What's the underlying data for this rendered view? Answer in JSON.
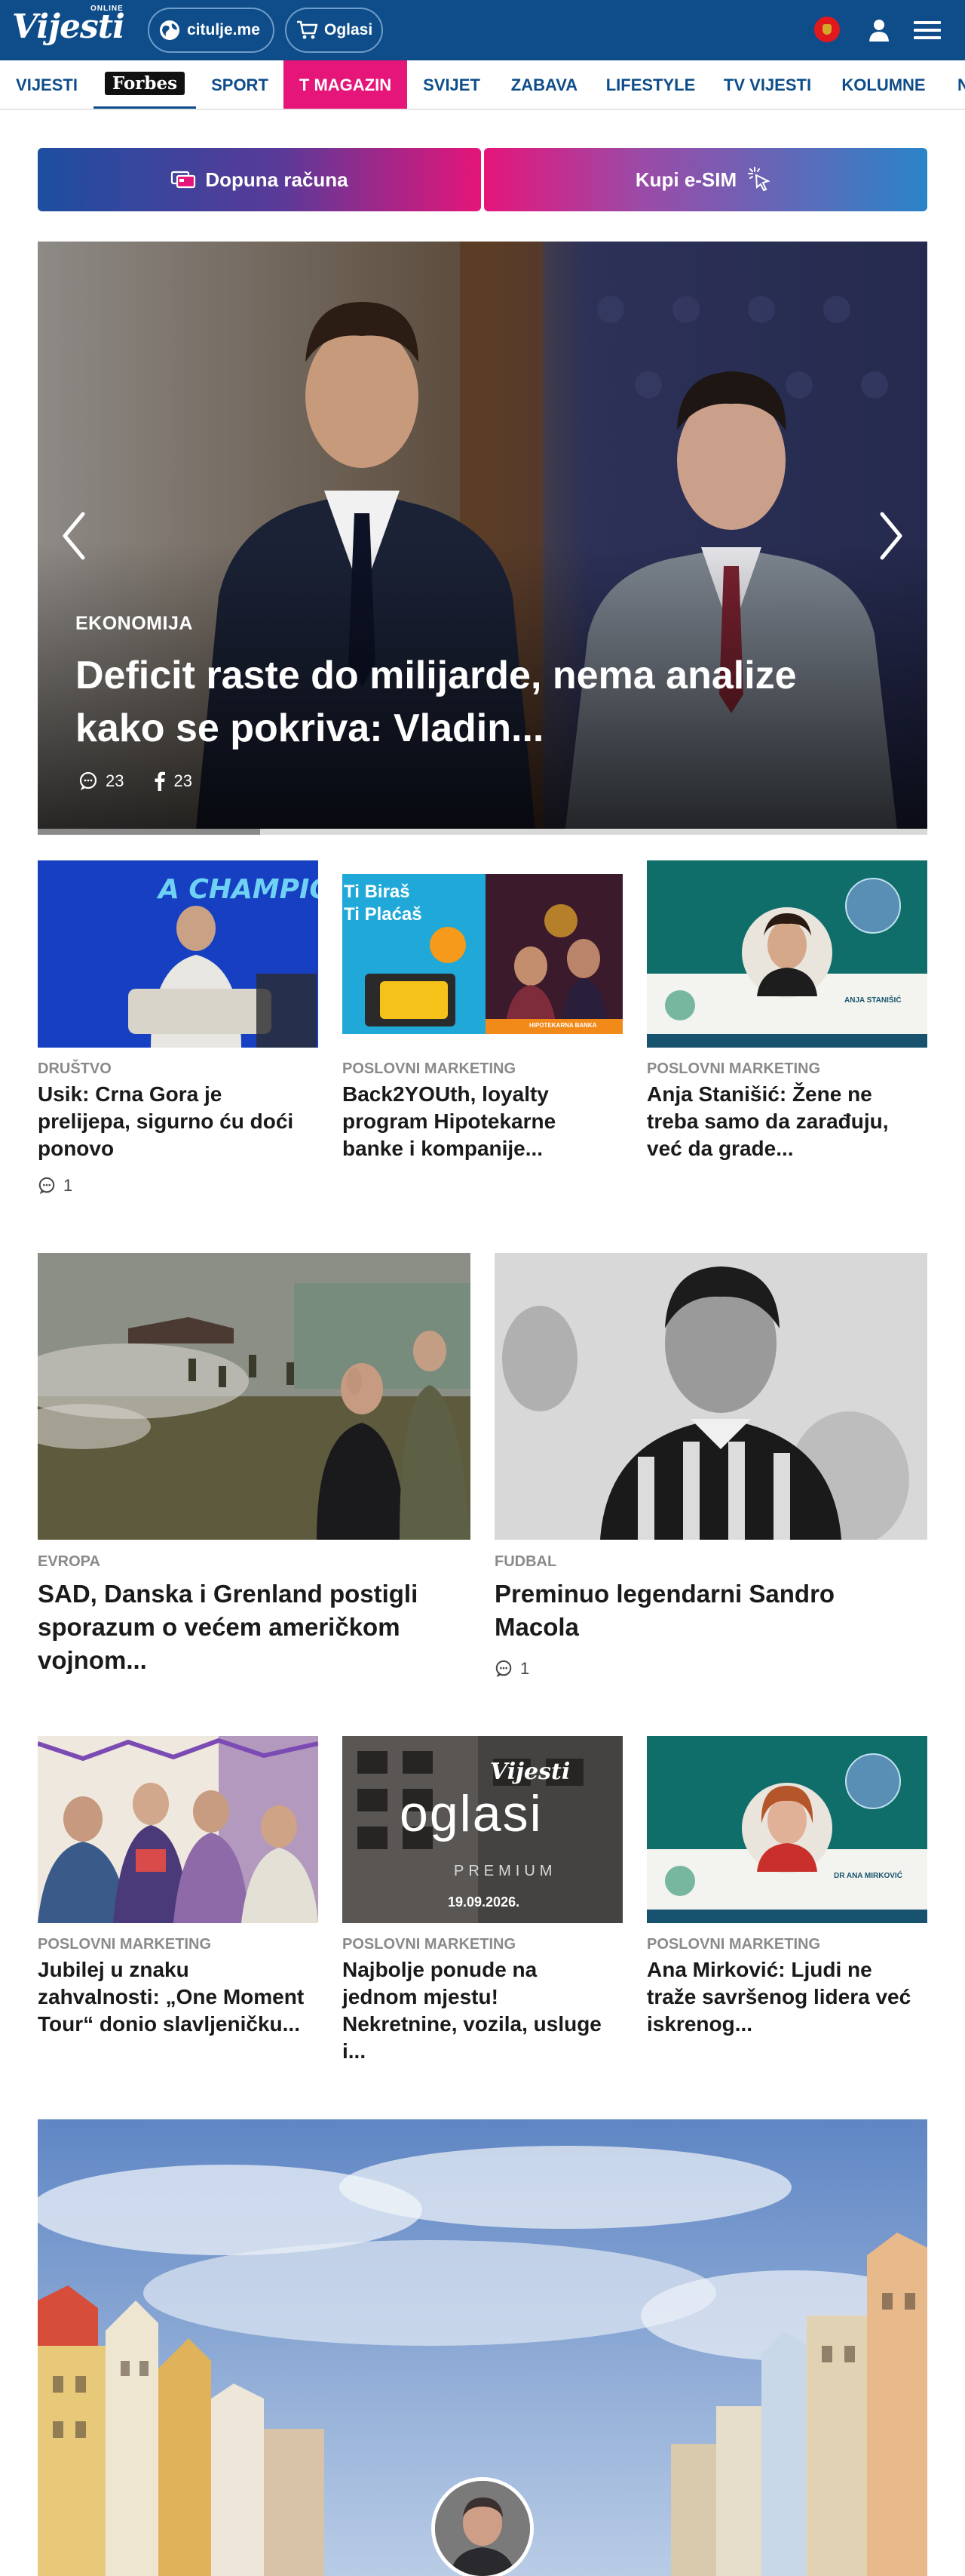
{
  "header": {
    "logo_text": "Vijesti",
    "logo_online": "ONLINE",
    "citulje_label": "citulje.me",
    "oglasi_label": "Oglasi",
    "brand_color": "#0e4d8a",
    "accent_color": "#e5157a"
  },
  "nav": {
    "items": [
      "VIJESTI",
      "Forbes",
      "SPORT",
      "T MAGAZIN",
      "SVIJET",
      "ZABAVA",
      "LIFESTYLE",
      "TV VIJESTI",
      "KOLUMNE",
      "N"
    ]
  },
  "promo": {
    "left_label": "Dopuna računa",
    "right_label": "Kupi e-SIM"
  },
  "hero": {
    "category": "EKONOMIJA",
    "title": "Deficit raste do milijarde, nema analize kako se pokriva: Vladin...",
    "comments": "23",
    "shares": "23",
    "slide_progress": 0.25
  },
  "row1": [
    {
      "category": "DRUŠTVO",
      "title": "Usik: Crna Gora je prelijepa, sigurno ću doći ponovo",
      "comments": "1"
    },
    {
      "category": "POSLOVNI MARKETING",
      "title": "Back2YOUth, loyalty program Hipotekarne banke i kompanije...",
      "image_text": {
        "line1": "Ti Biraš",
        "line2": "Ti Plaćaš",
        "tag": "HIPOTEKARNA BANKA"
      }
    },
    {
      "category": "POSLOVNI MARKETING",
      "title": "Anja Stanišić: Žene ne treba samo da zarađuju, već da grade...",
      "image_text": {
        "badge": "ANJA STANIŠIĆ"
      }
    }
  ],
  "row2": [
    {
      "category": "EVROPA",
      "title": "SAD, Danska i Grenland postigli sporazum o većem američkom vojnom..."
    },
    {
      "category": "FUDBAL",
      "title": "Preminuo legendarni Sandro Macola",
      "comments": "1"
    }
  ],
  "row3": [
    {
      "category": "POSLOVNI MARKETING",
      "title": "Jubilej u znaku zahvalnosti: „One Moment Tour“ donio slavljeničku..."
    },
    {
      "category": "POSLOVNI MARKETING",
      "title": "Najbolje ponude na jednom mjestu! Nekretnine, vozila, usluge i...",
      "image_text": {
        "brand": "Vijesti",
        "word": "oglasi",
        "sub": "PREMIUM",
        "date": "19.09.2026."
      }
    },
    {
      "category": "POSLOVNI MARKETING",
      "title": "Ana Mirković: Ljudi ne traže savršenog lidera već iskrenog...",
      "image_text": {
        "badge": "DR ANA MIRKOVIĆ"
      }
    }
  ]
}
